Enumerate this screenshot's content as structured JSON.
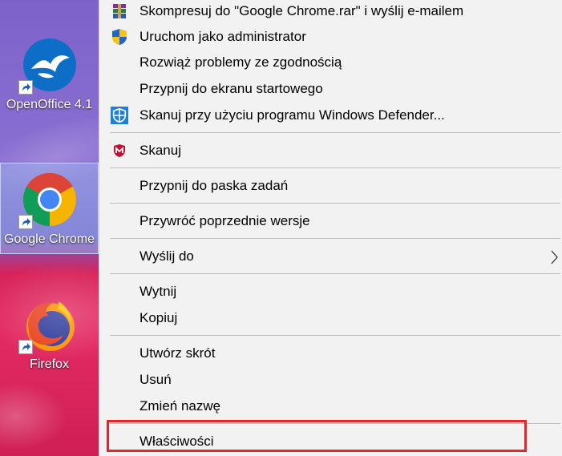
{
  "desktop": {
    "icons": [
      {
        "label": "OpenOffice 4.1",
        "icon": "openoffice-icon"
      },
      {
        "label": "Google Chrome",
        "icon": "chrome-icon"
      },
      {
        "label": "Firefox",
        "icon": "firefox-icon"
      }
    ]
  },
  "menu": {
    "items": [
      {
        "label": "Skompresuj do \"Google Chrome.rar\" i wyślij e-mailem",
        "icon": "winrar-icon"
      },
      {
        "label": "Uruchom jako administrator",
        "icon": "uac-shield-icon"
      },
      {
        "label": "Rozwiąż problemy ze zgodnością"
      },
      {
        "label": "Przypnij do ekranu startowego"
      },
      {
        "label": "Skanuj przy użyciu programu Windows Defender...",
        "icon": "windows-defender-icon"
      },
      {
        "label": "Skanuj",
        "icon": "mcafee-icon"
      },
      {
        "label": "Przypnij do paska zadań"
      },
      {
        "label": "Przywróć poprzednie wersje"
      },
      {
        "label": "Wyślij do",
        "icon": "chevron-right-icon"
      },
      {
        "label": "Wytnij"
      },
      {
        "label": "Kopiuj"
      },
      {
        "label": "Utwórz skrót"
      },
      {
        "label": "Usuń"
      },
      {
        "label": "Zmień nazwę"
      },
      {
        "label": "Właściwości"
      }
    ]
  },
  "colors": {
    "menu_background": "#f2f2f2",
    "highlight_border": "#e3262b",
    "separator": "#bdbdbd"
  }
}
